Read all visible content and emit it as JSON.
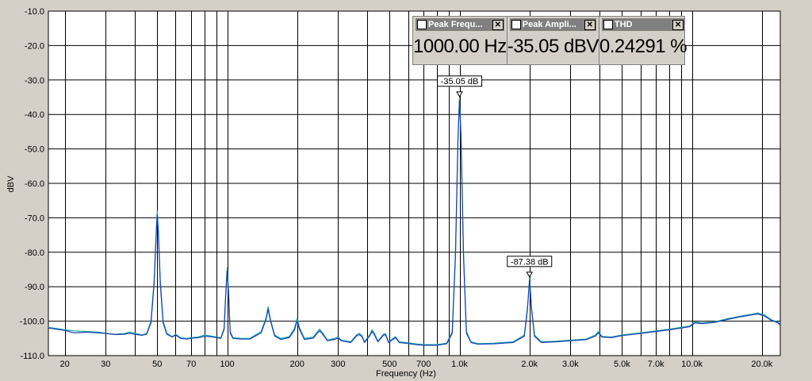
{
  "chart_data": {
    "type": "line",
    "xlabel": "Frequency (Hz)",
    "ylabel": "dBV",
    "x_scale": "log",
    "xlim": [
      17,
      24000
    ],
    "ylim": [
      -110,
      -10
    ],
    "grid": true,
    "y_ticks": [
      "-10.0",
      "-20.0",
      "-30.0",
      "-40.0",
      "-50.0",
      "-60.0",
      "-70.0",
      "-80.0",
      "-90.0",
      "-100.0",
      "-110.0"
    ],
    "y_tick_values": [
      -10,
      -20,
      -30,
      -40,
      -50,
      -60,
      -70,
      -80,
      -90,
      -100,
      -110
    ],
    "x_ticks": [
      {
        "v": 20,
        "label": "20"
      },
      {
        "v": 30,
        "label": "30"
      },
      {
        "v": 50,
        "label": "50"
      },
      {
        "v": 70,
        "label": "70"
      },
      {
        "v": 100,
        "label": "100"
      },
      {
        "v": 200,
        "label": "200"
      },
      {
        "v": 300,
        "label": "300"
      },
      {
        "v": 500,
        "label": "500"
      },
      {
        "v": 700,
        "label": "700"
      },
      {
        "v": 1000,
        "label": "1.0k"
      },
      {
        "v": 2000,
        "label": "2.0k"
      },
      {
        "v": 3000,
        "label": "3.0k"
      },
      {
        "v": 5000,
        "label": "5.0k"
      },
      {
        "v": 7000,
        "label": "7.0k"
      },
      {
        "v": 10000,
        "label": "10.0k"
      },
      {
        "v": 20000,
        "label": "20.0k"
      }
    ],
    "gridlines_x": [
      20,
      30,
      40,
      50,
      60,
      70,
      80,
      90,
      100,
      200,
      300,
      400,
      500,
      600,
      700,
      800,
      900,
      1000,
      2000,
      3000,
      4000,
      5000,
      6000,
      7000,
      8000,
      9000,
      10000,
      20000
    ],
    "colors": {
      "trace_a": "#1fa8a8",
      "trace_b": "#1a3fb0",
      "grid": "#000000",
      "plot_bg": "#ffffff"
    },
    "series": [
      {
        "color": "#1fa8a8",
        "points": [
          [
            17,
            -101.8
          ],
          [
            18,
            -102
          ],
          [
            20,
            -102.5
          ],
          [
            22,
            -102.8
          ],
          [
            25,
            -103
          ],
          [
            28,
            -103.2
          ],
          [
            30,
            -103.5
          ],
          [
            33,
            -103.8
          ],
          [
            36,
            -103.6
          ],
          [
            38,
            -103.2
          ],
          [
            40,
            -103.5
          ],
          [
            43,
            -104
          ],
          [
            45,
            -103.6
          ],
          [
            47,
            -100
          ],
          [
            48.5,
            -88
          ],
          [
            49.5,
            -74
          ],
          [
            50,
            -68
          ],
          [
            50.6,
            -74
          ],
          [
            51.5,
            -88
          ],
          [
            53,
            -100
          ],
          [
            55,
            -103.5
          ],
          [
            58,
            -104.5
          ],
          [
            60,
            -103.8
          ],
          [
            63,
            -104.8
          ],
          [
            67,
            -105
          ],
          [
            70,
            -104.8
          ],
          [
            75,
            -104.6
          ],
          [
            80,
            -104
          ],
          [
            85,
            -104.3
          ],
          [
            90,
            -104.6
          ],
          [
            94,
            -104.8
          ],
          [
            97,
            -102
          ],
          [
            98.5,
            -92
          ],
          [
            100,
            -84.5
          ],
          [
            101.5,
            -92
          ],
          [
            103,
            -103
          ],
          [
            106,
            -104.8
          ],
          [
            115,
            -105
          ],
          [
            125,
            -105
          ],
          [
            140,
            -103
          ],
          [
            147,
            -99
          ],
          [
            150,
            -95.8
          ],
          [
            153,
            -99
          ],
          [
            160,
            -104
          ],
          [
            170,
            -105
          ],
          [
            185,
            -104.5
          ],
          [
            195,
            -102
          ],
          [
            200,
            -99.2
          ],
          [
            205,
            -102
          ],
          [
            215,
            -105
          ],
          [
            235,
            -104.6
          ],
          [
            245,
            -103
          ],
          [
            250,
            -102.3
          ],
          [
            255,
            -103
          ],
          [
            270,
            -105.5
          ],
          [
            290,
            -105
          ],
          [
            300,
            -104.6
          ],
          [
            310,
            -105.5
          ],
          [
            340,
            -106
          ],
          [
            360,
            -104
          ],
          [
            370,
            -103.5
          ],
          [
            380,
            -104.2
          ],
          [
            390,
            -106
          ],
          [
            410,
            -104
          ],
          [
            420,
            -102.5
          ],
          [
            430,
            -103.5
          ],
          [
            445,
            -105.8
          ],
          [
            470,
            -103.8
          ],
          [
            480,
            -103.6
          ],
          [
            495,
            -106
          ],
          [
            530,
            -104.5
          ],
          [
            550,
            -106
          ],
          [
            600,
            -106.3
          ],
          [
            650,
            -106.6
          ],
          [
            700,
            -106.8
          ],
          [
            800,
            -106.8
          ],
          [
            880,
            -106.4
          ],
          [
            930,
            -103
          ],
          [
            960,
            -80
          ],
          [
            985,
            -46
          ],
          [
            1000,
            -35.05
          ],
          [
            1015,
            -46
          ],
          [
            1040,
            -80
          ],
          [
            1070,
            -103
          ],
          [
            1120,
            -106
          ],
          [
            1200,
            -106.5
          ],
          [
            1400,
            -106.4
          ],
          [
            1700,
            -106
          ],
          [
            1900,
            -104
          ],
          [
            1960,
            -96
          ],
          [
            2000,
            -87.38
          ],
          [
            2040,
            -96
          ],
          [
            2100,
            -104
          ],
          [
            2250,
            -106
          ],
          [
            2600,
            -105.8
          ],
          [
            3000,
            -105.5
          ],
          [
            3500,
            -105.2
          ],
          [
            3850,
            -104
          ],
          [
            3950,
            -103
          ],
          [
            4100,
            -104.4
          ],
          [
            4500,
            -104.6
          ],
          [
            5000,
            -104
          ],
          [
            6000,
            -103.4
          ],
          [
            7000,
            -102.8
          ],
          [
            8000,
            -102.3
          ],
          [
            9000,
            -101.8
          ],
          [
            9800,
            -101.4
          ],
          [
            10300,
            -100.2
          ],
          [
            11000,
            -100.5
          ],
          [
            12500,
            -100.2
          ],
          [
            14000,
            -99.4
          ],
          [
            16000,
            -98.6
          ],
          [
            18000,
            -98
          ],
          [
            19200,
            -97.6
          ],
          [
            20500,
            -98.2
          ],
          [
            22000,
            -99.6
          ],
          [
            23500,
            -100.3
          ],
          [
            24000,
            -101
          ]
        ]
      },
      {
        "color": "#1a3fb0",
        "points": [
          [
            17,
            -102
          ],
          [
            20,
            -102.7
          ],
          [
            22,
            -103.4
          ],
          [
            25,
            -103.2
          ],
          [
            28,
            -103.4
          ],
          [
            30,
            -103.6
          ],
          [
            33,
            -103.9
          ],
          [
            36,
            -103.8
          ],
          [
            38,
            -103.5
          ],
          [
            40,
            -103.8
          ],
          [
            43,
            -104.1
          ],
          [
            45,
            -103.8
          ],
          [
            47,
            -100.5
          ],
          [
            48.5,
            -89
          ],
          [
            49.5,
            -75
          ],
          [
            50,
            -69
          ],
          [
            50.6,
            -75
          ],
          [
            51.5,
            -89
          ],
          [
            53,
            -100.5
          ],
          [
            55,
            -103.8
          ],
          [
            58,
            -104.6
          ],
          [
            60,
            -104
          ],
          [
            63,
            -105
          ],
          [
            67,
            -105.2
          ],
          [
            70,
            -105
          ],
          [
            75,
            -104.8
          ],
          [
            80,
            -104.4
          ],
          [
            85,
            -104.5
          ],
          [
            90,
            -104.8
          ],
          [
            94,
            -105
          ],
          [
            97,
            -102.4
          ],
          [
            98.5,
            -93
          ],
          [
            100,
            -85.5
          ],
          [
            101.5,
            -93
          ],
          [
            103,
            -103.5
          ],
          [
            106,
            -105
          ],
          [
            115,
            -105.2
          ],
          [
            125,
            -105.2
          ],
          [
            140,
            -103.4
          ],
          [
            147,
            -99.5
          ],
          [
            150,
            -96.5
          ],
          [
            153,
            -99.5
          ],
          [
            160,
            -104.3
          ],
          [
            170,
            -105.3
          ],
          [
            185,
            -104.8
          ],
          [
            195,
            -102.5
          ],
          [
            200,
            -100
          ],
          [
            205,
            -102.5
          ],
          [
            215,
            -105.3
          ],
          [
            235,
            -104.9
          ],
          [
            245,
            -103.4
          ],
          [
            250,
            -102.8
          ],
          [
            255,
            -103.4
          ],
          [
            270,
            -105.7
          ],
          [
            290,
            -105.3
          ],
          [
            300,
            -104.9
          ],
          [
            310,
            -105.7
          ],
          [
            340,
            -106.2
          ],
          [
            360,
            -104.3
          ],
          [
            370,
            -103.9
          ],
          [
            380,
            -104.5
          ],
          [
            390,
            -106.2
          ],
          [
            410,
            -104.3
          ],
          [
            420,
            -103
          ],
          [
            430,
            -103.9
          ],
          [
            445,
            -106
          ],
          [
            470,
            -104.1
          ],
          [
            480,
            -103.9
          ],
          [
            495,
            -106.2
          ],
          [
            530,
            -104.8
          ],
          [
            550,
            -106.2
          ],
          [
            600,
            -106.5
          ],
          [
            650,
            -106.8
          ],
          [
            700,
            -107
          ],
          [
            800,
            -107
          ],
          [
            880,
            -106.6
          ],
          [
            930,
            -103.5
          ],
          [
            960,
            -81
          ],
          [
            985,
            -47
          ],
          [
            1000,
            -36
          ],
          [
            1015,
            -47
          ],
          [
            1040,
            -81
          ],
          [
            1070,
            -103.5
          ],
          [
            1120,
            -106.2
          ],
          [
            1200,
            -106.7
          ],
          [
            1400,
            -106.6
          ],
          [
            1700,
            -106.2
          ],
          [
            1900,
            -104.4
          ],
          [
            1960,
            -96.5
          ],
          [
            2000,
            -88.2
          ],
          [
            2040,
            -96.5
          ],
          [
            2100,
            -104.4
          ],
          [
            2250,
            -106.2
          ],
          [
            2600,
            -106
          ],
          [
            3000,
            -105.7
          ],
          [
            3500,
            -105.4
          ],
          [
            3850,
            -104.3
          ],
          [
            3950,
            -103.4
          ],
          [
            4100,
            -104.6
          ],
          [
            4500,
            -104.8
          ],
          [
            5000,
            -104.2
          ],
          [
            6000,
            -103.6
          ],
          [
            7000,
            -103
          ],
          [
            8000,
            -102.5
          ],
          [
            9000,
            -102
          ],
          [
            9800,
            -101.6
          ],
          [
            10300,
            -100.5
          ],
          [
            11000,
            -100.7
          ],
          [
            12500,
            -100.4
          ],
          [
            14000,
            -99.6
          ],
          [
            16000,
            -98.8
          ],
          [
            18000,
            -98.2
          ],
          [
            19200,
            -97.9
          ],
          [
            20500,
            -98.5
          ],
          [
            22000,
            -99.8
          ],
          [
            23500,
            -100.5
          ],
          [
            24000,
            -101.2
          ]
        ]
      }
    ],
    "markers": [
      {
        "x": 1000,
        "y": -35.05,
        "label": "-35.05 dB"
      },
      {
        "x": 2000,
        "y": -87.38,
        "label": "-87.38 dB"
      }
    ]
  },
  "meters": [
    {
      "title": "Peak Frequ...",
      "value": "1000.00 Hz",
      "icon": "waveform-icon"
    },
    {
      "title": "Peak Ampli...",
      "value": "-35.05 dBV",
      "icon": "waveform-icon"
    },
    {
      "title": "THD",
      "value": "0.24291 %",
      "icon": "waveform-icon"
    }
  ]
}
